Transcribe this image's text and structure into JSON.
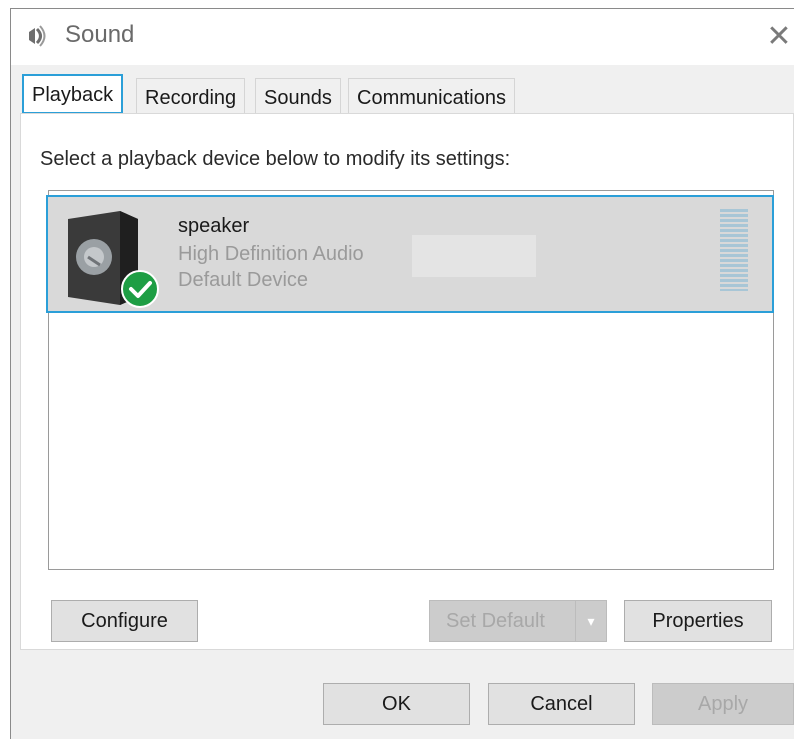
{
  "window": {
    "title": "Sound",
    "close_glyph": "✕"
  },
  "tabs": [
    {
      "label": "Playback",
      "active": true
    },
    {
      "label": "Recording",
      "active": false
    },
    {
      "label": "Sounds",
      "active": false
    },
    {
      "label": "Communications",
      "active": false
    }
  ],
  "playback": {
    "instruction": "Select a playback device below to modify its settings:",
    "devices": [
      {
        "name": "speaker",
        "description": "High Definition Audio",
        "status": "Default Device",
        "icon": "speaker-icon",
        "status_icon": "green-check-icon",
        "selected": true
      }
    ]
  },
  "buttons": {
    "configure": "Configure",
    "set_default": "Set Default",
    "set_default_arrow": "▾",
    "properties": "Properties",
    "ok": "OK",
    "cancel": "Cancel",
    "apply": "Apply"
  },
  "colors": {
    "accent": "#2b9fd8",
    "default_check": "#1e9e44"
  }
}
